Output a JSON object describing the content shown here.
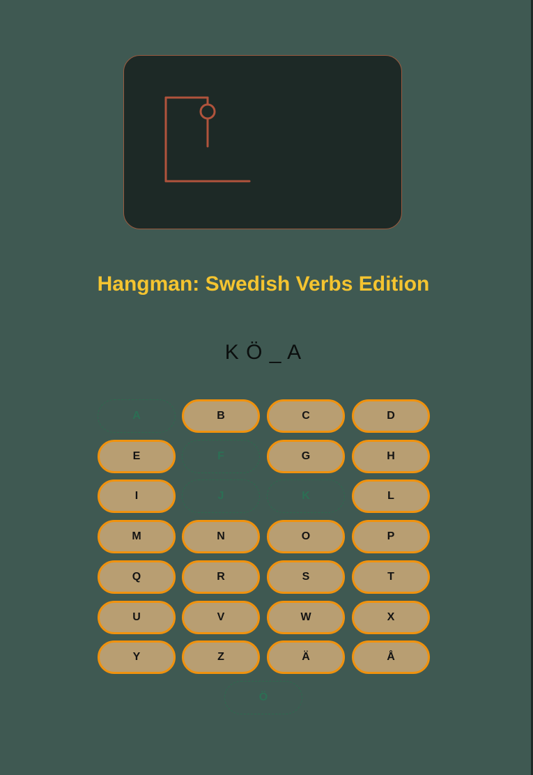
{
  "game": {
    "title": "Hangman: Swedish Verbs Edition",
    "word_display": "K Ö _ A",
    "wrong_guesses": 1
  },
  "colors": {
    "background": "#3f5952",
    "panel": "#1d2926",
    "gallows": "#b0533c",
    "title": "#f4c430",
    "key_fill": "#b89e72",
    "key_border": "#f0920e",
    "key_used": "#2c6f54"
  },
  "keyboard": {
    "keys": [
      {
        "letter": "A",
        "used": true
      },
      {
        "letter": "B",
        "used": false
      },
      {
        "letter": "C",
        "used": false
      },
      {
        "letter": "D",
        "used": false
      },
      {
        "letter": "E",
        "used": false
      },
      {
        "letter": "F",
        "used": true
      },
      {
        "letter": "G",
        "used": false
      },
      {
        "letter": "H",
        "used": false
      },
      {
        "letter": "I",
        "used": false
      },
      {
        "letter": "J",
        "used": true
      },
      {
        "letter": "K",
        "used": true
      },
      {
        "letter": "L",
        "used": false
      },
      {
        "letter": "M",
        "used": false
      },
      {
        "letter": "N",
        "used": false
      },
      {
        "letter": "O",
        "used": false
      },
      {
        "letter": "P",
        "used": false
      },
      {
        "letter": "Q",
        "used": false
      },
      {
        "letter": "R",
        "used": false
      },
      {
        "letter": "S",
        "used": false
      },
      {
        "letter": "T",
        "used": false
      },
      {
        "letter": "U",
        "used": false
      },
      {
        "letter": "V",
        "used": false
      },
      {
        "letter": "W",
        "used": false
      },
      {
        "letter": "X",
        "used": false
      },
      {
        "letter": "Y",
        "used": false
      },
      {
        "letter": "Z",
        "used": false
      },
      {
        "letter": "Ä",
        "used": false
      },
      {
        "letter": "Å",
        "used": false
      },
      {
        "letter": "Ö",
        "used": true
      }
    ]
  }
}
